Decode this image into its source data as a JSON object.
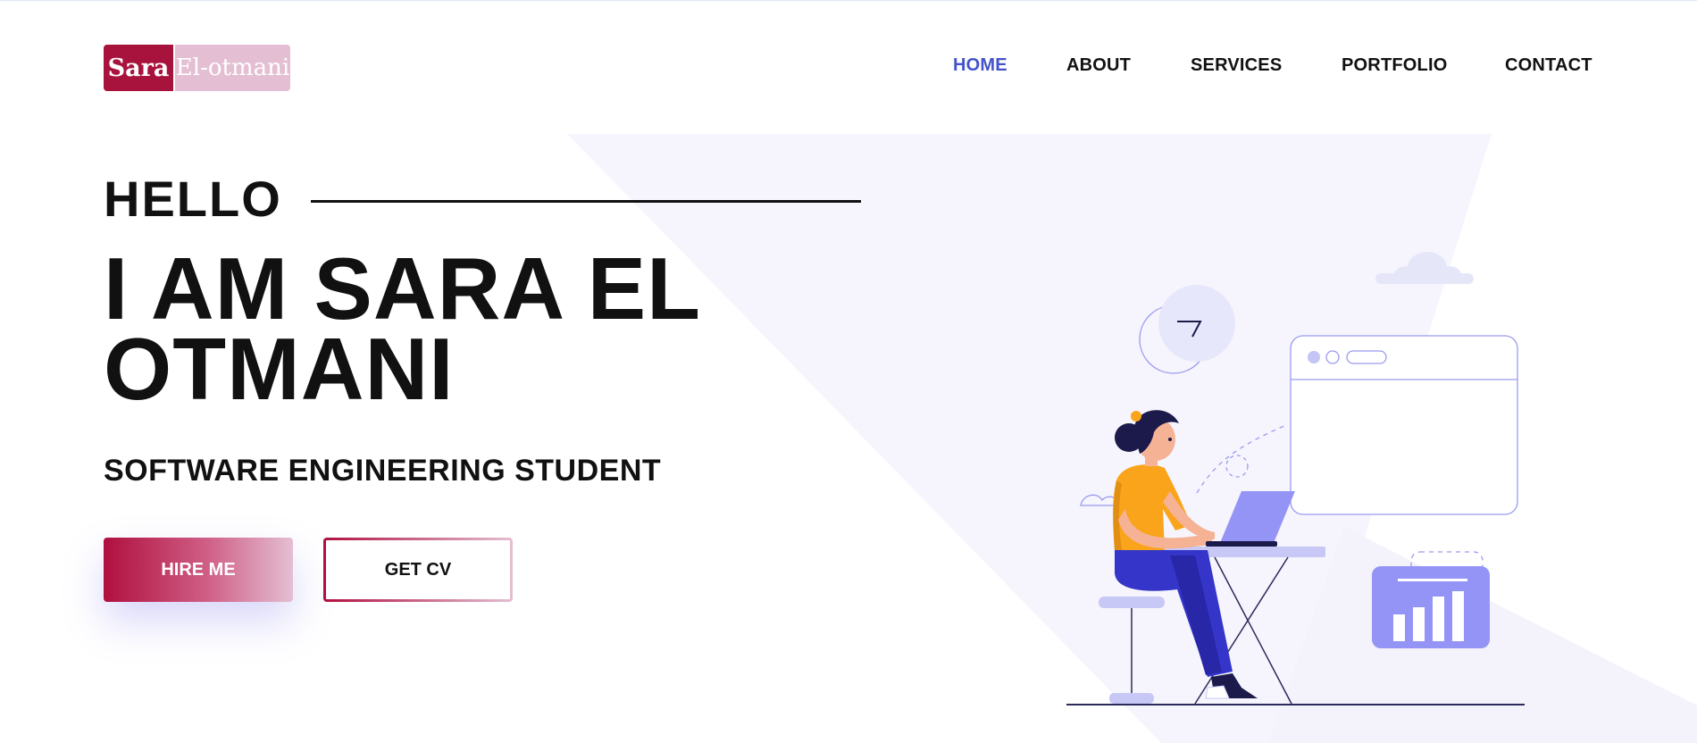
{
  "logo": {
    "first": "Sara",
    "second": "El-otmani"
  },
  "nav": {
    "items": [
      {
        "label": "HOME",
        "active": true
      },
      {
        "label": "ABOUT",
        "active": false
      },
      {
        "label": "SERVICES",
        "active": false
      },
      {
        "label": "PORTFOLIO",
        "active": false
      },
      {
        "label": "CONTACT",
        "active": false
      }
    ]
  },
  "hero": {
    "greeting": "HELLO",
    "name": "I AM SARA EL OTMANI",
    "role": "SOFTWARE ENGINEERING STUDENT",
    "hire_label": "HIRE ME",
    "cv_label": "GET CV"
  },
  "colors": {
    "brand": "#a8133e",
    "brand_light": "#e4bfd3",
    "nav_active": "#4353c9",
    "illustration_accent": "#9494f7"
  },
  "icons": {
    "illustration": "woman-working-on-laptop-illustration",
    "chart": "bar-chart-icon",
    "clock": "clock-icon"
  }
}
